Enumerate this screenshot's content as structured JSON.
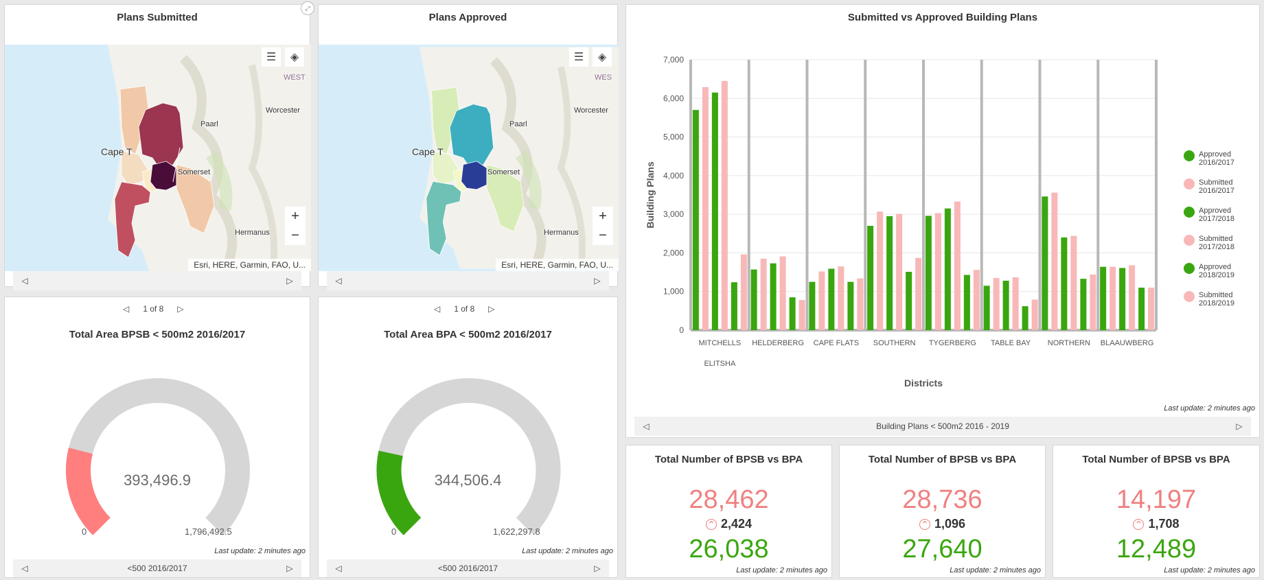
{
  "map1": {
    "title": "Plans Submitted",
    "labels": {
      "cape": "Cape T",
      "paarl": "Paarl",
      "worcester": "Worcester",
      "somerset": "Somerset",
      "hermanus": "Hermanus",
      "west": "WEST"
    },
    "attribution": "Esri, HERE, Garmin, FAO, U...",
    "colors": [
      "#f2c9a8",
      "#9b3550",
      "#c0505f",
      "#4a0d3a",
      "#f4dcc1",
      "#fbe9c8"
    ]
  },
  "map2": {
    "title": "Plans Approved",
    "labels": {
      "cape": "Cape T",
      "paarl": "Paarl",
      "worcester": "Worcester",
      "somerset": "Somerset",
      "hermanus": "Hermanus",
      "west": "WES"
    },
    "attribution": "Esri, HERE, Garmin, FAO, U...",
    "colors": [
      "#d8ecb7",
      "#3caec0",
      "#6fc1b5",
      "#2a3d96",
      "#e6f2c7",
      "#f3f7c9"
    ]
  },
  "pagers": {
    "page_text": "1 of 8",
    "gauge1_footer": "<500 2016/2017",
    "gauge2_footer": "<500 2016/2017",
    "chart_footer": "Building Plans < 500m2 2016 - 2019"
  },
  "gauge1": {
    "title": "Total Area BPSB < 500m2 2016/2017",
    "value": "393,496.9",
    "min": "0",
    "max": "1,796,492.5",
    "fraction": 0.219,
    "color": "#ff7f7f",
    "stamp": "Last update: 2 minutes ago"
  },
  "gauge2": {
    "title": "Total Area BPA < 500m2 2016/2017",
    "value": "344,506.4",
    "min": "0",
    "max": "1,622,297.8",
    "fraction": 0.212,
    "color": "#3aa60f",
    "stamp": "Last update: 2 minutes ago"
  },
  "indicators": [
    {
      "title": "Total Number of BPSB vs BPA",
      "top": "28,462",
      "delta": "2,424",
      "bottom": "26,038",
      "stamp": "Last update: 2 minutes ago"
    },
    {
      "title": "Total Number of BPSB vs BPA",
      "top": "28,736",
      "delta": "1,096",
      "bottom": "27,640",
      "stamp": "Last update: 2 minutes ago"
    },
    {
      "title": "Total Number of BPSB vs BPA",
      "top": "14,197",
      "delta": "1,708",
      "bottom": "12,489",
      "stamp": "Last update: 2 minutes ago"
    }
  ],
  "chart_stamp": "Last update: 2 minutes ago",
  "chart_data": {
    "type": "bar",
    "title": "Submitted vs Approved Building Plans",
    "xlabel": "Districts",
    "ylabel": "Building Plans",
    "ylim": [
      0,
      7000
    ],
    "yticks": [
      "0",
      "1,000",
      "2,000",
      "3,000",
      "4,000",
      "5,000",
      "6,000",
      "7,000"
    ],
    "categories": [
      "MITCHELLS PLAIN/ KHAYELITSHA",
      "HELDERBERG",
      "CAPE FLATS",
      "SOUTHERN",
      "TYGERBERG",
      "TABLE BAY",
      "NORTHERN",
      "BLAAUWBERG"
    ],
    "category_labels": [
      "MITCHELLS",
      "HELDERBERG",
      "CAPE FLATS",
      "SOUTHERN",
      "TYGERBERG",
      "TABLE BAY",
      "NORTHERN",
      "BLAAUWBERG"
    ],
    "category_sublabel": "ELITSHA",
    "grid": true,
    "legend_position": "right",
    "series": [
      {
        "name": "Approved 2016/2017",
        "color": "#3aa60f",
        "values": [
          5700,
          1570,
          1250,
          2700,
          2960,
          1150,
          3460,
          1640
        ]
      },
      {
        "name": "Submitted 2016/2017",
        "color": "#f8b8b8",
        "values": [
          6290,
          1850,
          1520,
          3070,
          3030,
          1350,
          3560,
          1640
        ]
      },
      {
        "name": "Approved 2017/2018",
        "color": "#3aa60f",
        "values": [
          6150,
          1730,
          1590,
          2950,
          3150,
          1280,
          2400,
          1610
        ]
      },
      {
        "name": "Submitted 2017/2018",
        "color": "#f8b8b8",
        "values": [
          6450,
          1910,
          1650,
          3010,
          3330,
          1370,
          2440,
          1680
        ]
      },
      {
        "name": "Approved 2018/2019",
        "color": "#3aa60f",
        "values": [
          1240,
          850,
          1250,
          1510,
          1430,
          620,
          1330,
          1100
        ]
      },
      {
        "name": "Submitted 2018/2019",
        "color": "#f8b8b8",
        "values": [
          1960,
          780,
          1340,
          1870,
          1560,
          790,
          1440,
          1100
        ]
      }
    ],
    "legend_lines": [
      [
        "Approved",
        "2016/2017"
      ],
      [
        "Submitted",
        "2016/2017"
      ],
      [
        "Approved",
        "2017/2018"
      ],
      [
        "Submitted",
        "2017/2018"
      ],
      [
        "Approved",
        "2018/2019"
      ],
      [
        "Submitted",
        "2018/2019"
      ]
    ]
  }
}
